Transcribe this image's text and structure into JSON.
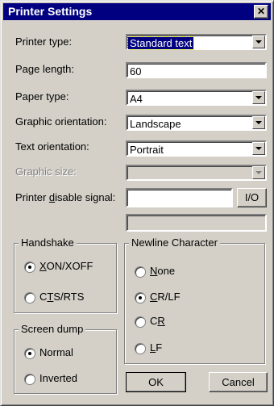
{
  "window": {
    "title": "Printer Settings"
  },
  "form": {
    "printer_type_label": "Printer type:",
    "printer_type_value": "Standard text",
    "page_length_label": "Page length:",
    "page_length_value": "60",
    "paper_type_label": "Paper type:",
    "paper_type_value": "A4",
    "graphic_orientation_label": "Graphic orientation:",
    "graphic_orientation_value": "Landscape",
    "text_orientation_label": "Text orientation:",
    "text_orientation_value": "Portrait",
    "graphic_size_label": "Graphic size:",
    "graphic_size_value": "",
    "disable_signal_label_pre": "Printer ",
    "disable_signal_label_u": "d",
    "disable_signal_label_post": "isable signal:",
    "disable_signal_value": "",
    "io_button": "I/O",
    "extra_field_value": ""
  },
  "handshake": {
    "legend": "Handshake",
    "opt1_u": "X",
    "opt1_rest": "ON/XOFF",
    "opt2_pre": "C",
    "opt2_u": "T",
    "opt2_rest": "S/RTS",
    "selected": "XON/XOFF"
  },
  "screendump": {
    "legend": "Screen dump",
    "opt1": "Normal",
    "opt2": "Inverted",
    "selected": "Normal"
  },
  "newline": {
    "legend": "Newline Character",
    "opt1_u": "N",
    "opt1_rest": "one",
    "opt2_u": "C",
    "opt2_rest": "R/LF",
    "opt3_pre": "C",
    "opt3_u": "R",
    "opt4_u": "L",
    "opt4_rest": "F",
    "selected": "CR/LF"
  },
  "buttons": {
    "ok": "OK",
    "cancel": "Cancel"
  },
  "icons": {
    "close": "close-icon",
    "dropdown": "chevron-down-icon"
  }
}
